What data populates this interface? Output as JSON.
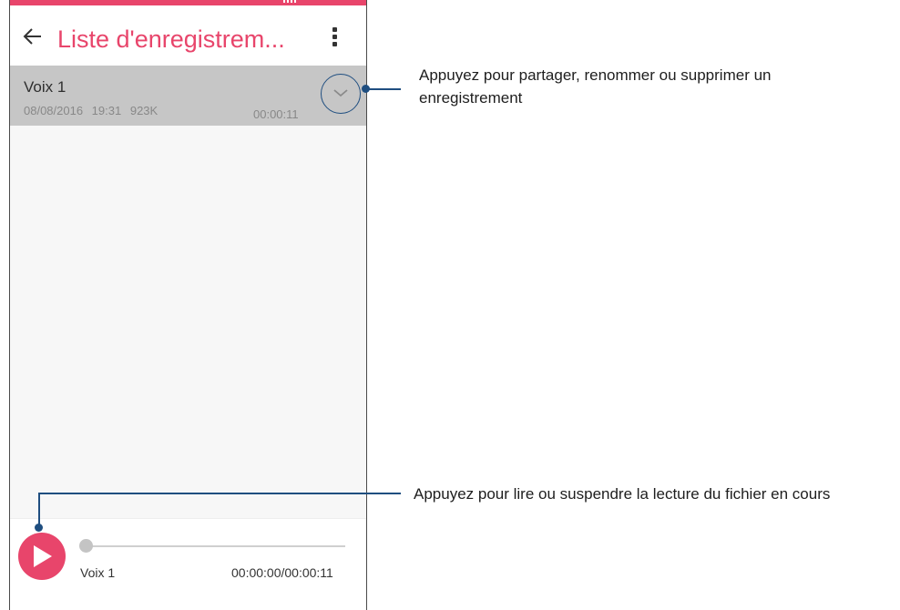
{
  "app": {
    "title": "Liste d'enregistrem...",
    "accent_color": "#e8456b"
  },
  "icons": {
    "back": "arrow-left-icon",
    "menu": "more-vert-icon",
    "expand": "chevron-down-icon",
    "play": "play-icon"
  },
  "recordings": [
    {
      "name": "Voix 1",
      "date": "08/08/2016 19:31",
      "size": "923K",
      "duration": "00:00:11"
    }
  ],
  "player": {
    "track_name": "Voix 1",
    "time": "00:00:00/00:00:11",
    "progress": 0
  },
  "callouts": {
    "share": "Appuyez pour partager, renommer ou supprimer un enregistrement",
    "play": "Appuyez pour lire ou suspendre la lecture du fichier en cours",
    "color": "#1f4e80"
  }
}
